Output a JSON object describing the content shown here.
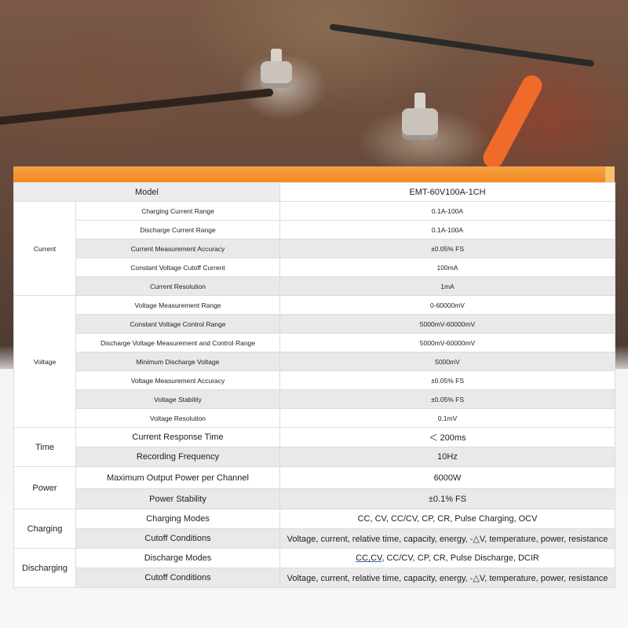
{
  "colors": {
    "accent_orange": "#f38a1e",
    "row_shade": "#e9e9e9",
    "text": "#1e1e1e"
  },
  "model": {
    "label": "Model",
    "value": "EMT-60V100A-1CH"
  },
  "groups": [
    {
      "category": "Current",
      "rows": [
        {
          "param": "Charging Current Range",
          "value": "0.1A-100A"
        },
        {
          "param": "Discharge Current Range",
          "value": "0.1A-100A"
        },
        {
          "param": "Current Measurement Accuracy",
          "value": "±0.05% FS"
        },
        {
          "param": "Constant Voltage Cutoff Current",
          "value": "100mA"
        },
        {
          "param": "Current Resolution",
          "value": "1mA"
        }
      ]
    },
    {
      "category": "Voltage",
      "rows": [
        {
          "param": "Voltage Measurement Range",
          "value": "0-60000mV"
        },
        {
          "param": "Constant Voltage Control Range",
          "value": "5000mV-60000mV"
        },
        {
          "param": "Discharge Voltage Measurement and Control Range",
          "value": "5000mV-60000mV"
        },
        {
          "param": "Minimum Discharge Voltage",
          "value": "5000mV"
        },
        {
          "param": "Voltage Measurement Accuracy",
          "value": "±0.05% FS"
        },
        {
          "param": "Voltage Stability",
          "value": "±0.05% FS"
        },
        {
          "param": "Voltage Resolution",
          "value": "0.1mV"
        }
      ]
    },
    {
      "category": "Time",
      "rows": [
        {
          "param": "Current Response Time",
          "value": "＜ 200ms"
        },
        {
          "param": "Recording Frequency",
          "value": "10Hz"
        }
      ]
    },
    {
      "category": "Power",
      "rows": [
        {
          "param": "Maximum Output Power per Channel",
          "value": "6000W"
        },
        {
          "param": "Power Stability",
          "value": "±0.1% FS"
        }
      ]
    },
    {
      "category": "Charging",
      "rows": [
        {
          "param": "Charging Modes",
          "value": "CC, CV, CC/CV, CP, CR, Pulse Charging, OCV"
        },
        {
          "param": "Cutoff Conditions",
          "value": "Voltage, current, relative time, capacity, energy, -△V, temperature, power, resistance"
        }
      ]
    },
    {
      "category": "Discharging",
      "rows": [
        {
          "param": "Discharge Modes",
          "value_underlined": "CC,CV",
          "value_rest": ", CC/CV, CP, CR, Pulse Discharge, DCIR"
        },
        {
          "param": "Cutoff Conditions",
          "value": "Voltage, current, relative time, capacity, energy, -△V, temperature, power, resistance"
        }
      ]
    }
  ]
}
